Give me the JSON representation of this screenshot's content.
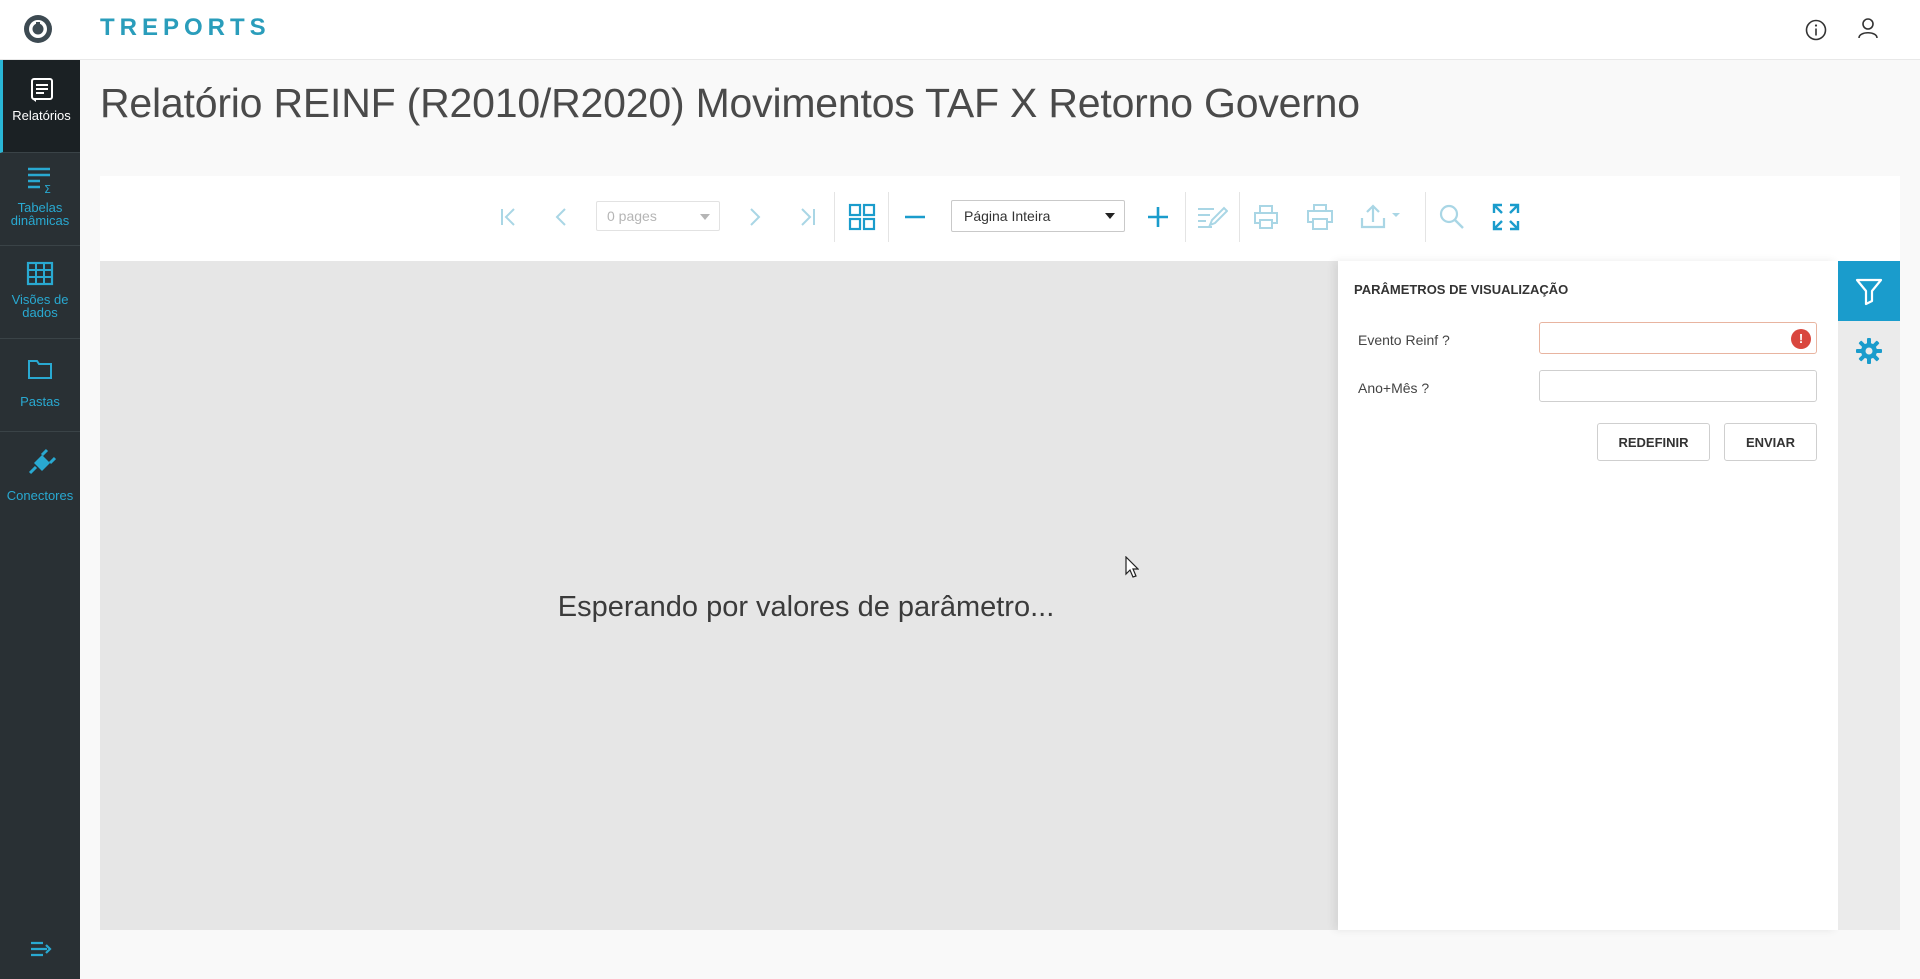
{
  "app": {
    "brand": "TREPORTS"
  },
  "sidebar": {
    "items": [
      {
        "label": "Relatórios",
        "icon": "report-icon"
      },
      {
        "label": "Tabelas dinâmicas",
        "icon": "pivot-table-icon"
      },
      {
        "label": "Visões de dados",
        "icon": "grid-table-icon"
      },
      {
        "label": "Pastas",
        "icon": "folder-icon"
      },
      {
        "label": "Conectores",
        "icon": "plug-icon"
      }
    ]
  },
  "page": {
    "title": "Relatório REINF (R2010/R2020) Movimentos TAF X Retorno Governo"
  },
  "toolbar": {
    "pages_value": "0 pages",
    "zoom_value": "Página Inteira"
  },
  "viewer": {
    "waiting_text": "Esperando por valores de parâmetro..."
  },
  "params": {
    "title": "PARÂMETROS DE VISUALIZAÇÃO",
    "fields": [
      {
        "label": "Evento Reinf ?",
        "value": "",
        "error": true
      },
      {
        "label": "Ano+Mês ?",
        "value": "",
        "error": false
      }
    ],
    "error_badge": "!",
    "reset_label": "REDEFINIR",
    "send_label": "ENVIAR"
  },
  "colors": {
    "accent": "#1a9ccc",
    "sidebar_bg": "#293034",
    "error": "#d9463e"
  }
}
